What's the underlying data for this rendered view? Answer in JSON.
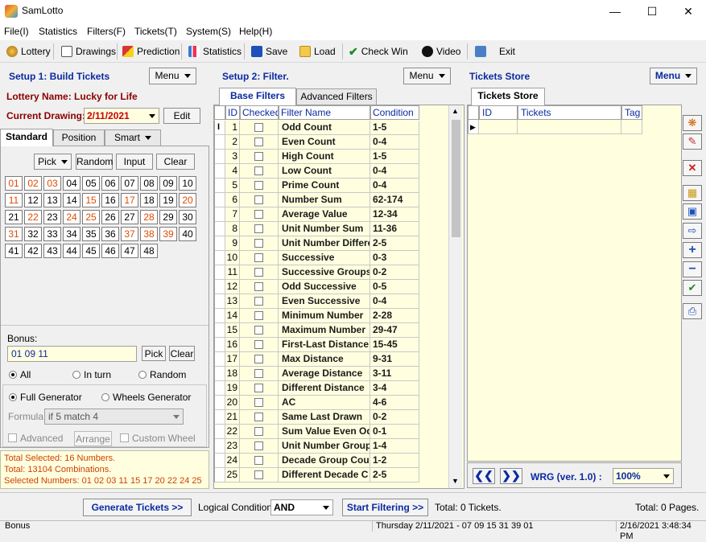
{
  "window": {
    "title": "SamLotto"
  },
  "menu": [
    "File(I)",
    "Statistics",
    "Filters(F)",
    "Tickets(T)",
    "System(S)",
    "Help(H)"
  ],
  "toolbar": [
    "Lottery",
    "Drawings",
    "Prediction",
    "Statistics",
    "Save",
    "Load",
    "Check Win",
    "Video",
    "Exit"
  ],
  "setup1": {
    "title": "Setup 1: Build  Tickets",
    "menu_label": "Menu",
    "lottery_label": "Lottery  Name:",
    "lottery_name": "Lucky for Life",
    "drawing_label": "Current Drawing:",
    "drawing_value": "2/11/2021",
    "edit_label": "Edit",
    "tabs": [
      "Standard",
      "Position",
      "Smart"
    ],
    "pick_label": "Pick",
    "random_label": "Random",
    "input_label": "Input",
    "clear_label": "Clear",
    "numbers": [
      "01",
      "02",
      "03",
      "04",
      "05",
      "06",
      "07",
      "08",
      "09",
      "10",
      "11",
      "12",
      "13",
      "14",
      "15",
      "16",
      "17",
      "18",
      "19",
      "20",
      "21",
      "22",
      "23",
      "24",
      "25",
      "26",
      "27",
      "28",
      "29",
      "30",
      "31",
      "32",
      "33",
      "34",
      "35",
      "36",
      "37",
      "38",
      "39",
      "40",
      "41",
      "42",
      "43",
      "44",
      "45",
      "46",
      "47",
      "48"
    ],
    "selected": [
      "01",
      "02",
      "03",
      "11",
      "15",
      "17",
      "20",
      "22",
      "24",
      "25",
      "28",
      "31",
      "37",
      "38",
      "39"
    ],
    "bonus_label": "Bonus:",
    "bonus_value": "01 09 11",
    "bonus_pick": "Pick",
    "bonus_clear": "Clear",
    "mode_options": [
      "All",
      "In turn",
      "Random"
    ],
    "generator_options": [
      "Full Generator",
      "Wheels Generator"
    ],
    "formula_label": "Formula:",
    "formula_value": "if 5 match 4",
    "advanced_label": "Advanced",
    "arrange_label": "Arrange",
    "custom_wheel_label": "Custom Wheel",
    "summary": [
      "Total Selected: 16 Numbers.",
      "Total: 13104 Combinations.",
      "Selected Numbers: 01 02 03 11 15 17 20 22 24 25"
    ]
  },
  "setup2": {
    "title": "Setup 2: Filter.",
    "menu_label": "Menu",
    "tabs": [
      "Base Filters",
      "Advanced Filters"
    ],
    "columns": [
      "ID",
      "Checked",
      "Filter Name",
      "Condition"
    ],
    "rows": [
      [
        "1",
        "Odd Count",
        "1-5"
      ],
      [
        "2",
        "Even Count",
        "0-4"
      ],
      [
        "3",
        "High Count",
        "1-5"
      ],
      [
        "4",
        "Low Count",
        "0-4"
      ],
      [
        "5",
        "Prime Count",
        "0-4"
      ],
      [
        "6",
        "Number Sum",
        "62-174"
      ],
      [
        "7",
        "Average Value",
        "12-34"
      ],
      [
        "8",
        "Unit Number Sum",
        "11-36"
      ],
      [
        "9",
        "Unit Number Differe",
        "2-5"
      ],
      [
        "10",
        "Successive",
        "0-3"
      ],
      [
        "11",
        "Successive Groups",
        "0-2"
      ],
      [
        "12",
        "Odd Successive",
        "0-5"
      ],
      [
        "13",
        "Even Successive",
        "0-4"
      ],
      [
        "14",
        "Minimum Number",
        "2-28"
      ],
      [
        "15",
        "Maximum Number",
        "29-47"
      ],
      [
        "16",
        "First-Last Distance",
        "15-45"
      ],
      [
        "17",
        "Max Distance",
        "9-31"
      ],
      [
        "18",
        "Average Distance",
        "3-11"
      ],
      [
        "19",
        "Different Distance",
        "3-4"
      ],
      [
        "20",
        "AC",
        "4-6"
      ],
      [
        "21",
        "Same Last Drawn",
        "0-2"
      ],
      [
        "22",
        "Sum Value Even Od",
        "0-1"
      ],
      [
        "23",
        "Unit Number Group",
        "1-4"
      ],
      [
        "24",
        "Decade Group Cour",
        "1-2"
      ],
      [
        "25",
        "Different Decade C",
        "2-5"
      ]
    ]
  },
  "tickets": {
    "title": "Tickets Store",
    "menu_label": "Menu",
    "tab": "Tickets Store",
    "columns": [
      "ID",
      "Tickets",
      "Tag"
    ],
    "wrg_label": "WRG (ver. 1.0) :",
    "zoom": "100%"
  },
  "bottom": {
    "generate_label": "Generate Tickets >>",
    "logic_label": "Logical Condition:",
    "logic_value": "AND",
    "start_label": "Start Filtering >>",
    "total_tickets": "Total: 0 Tickets.",
    "total_pages": "Total: 0 Pages."
  },
  "status": [
    "Bonus",
    "Thursday 2/11/2021 - 07 09 15 31 39 01",
    "2/16/2021 3:48:34 PM"
  ]
}
